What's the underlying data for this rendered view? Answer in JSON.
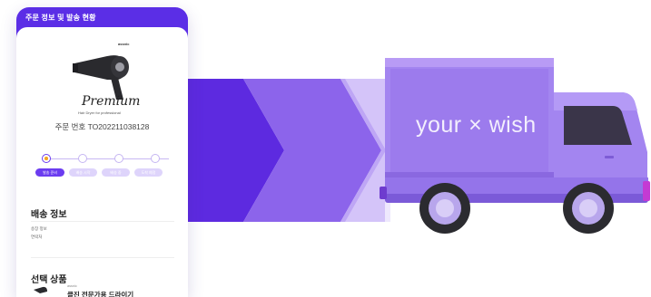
{
  "header": {
    "title": "주문 정보 및 발송 현황"
  },
  "product_image": {
    "brand": "assnic",
    "wordmark": "Premium",
    "subtitle": "Hair Dryer for professional"
  },
  "order": {
    "label": "주문 번호 TO202211038128"
  },
  "progress": {
    "current_step": 1,
    "total_steps": 4,
    "steps": [
      "발송 준비",
      "배송 시작",
      "배송 중",
      "도착 예정"
    ]
  },
  "shipping": {
    "title": "배송 정보",
    "fields": [
      "송장 정보",
      "연락처"
    ]
  },
  "products": {
    "title": "선택 상품",
    "item_brand": "assnic",
    "item_name": "클진 전문가용 드라이기"
  },
  "truck": {
    "label": "your × wish"
  },
  "colors": {
    "primary": "#5b2ee6",
    "band_dark": "#5d2ae0",
    "band_mid": "#8c64eb",
    "band_light": "#bea6f5",
    "band_pale": "#e3d9fb",
    "truck_body": "#a385f0",
    "pill_active": "#6b3cf0",
    "pill_inactive": "#ded4fb"
  }
}
